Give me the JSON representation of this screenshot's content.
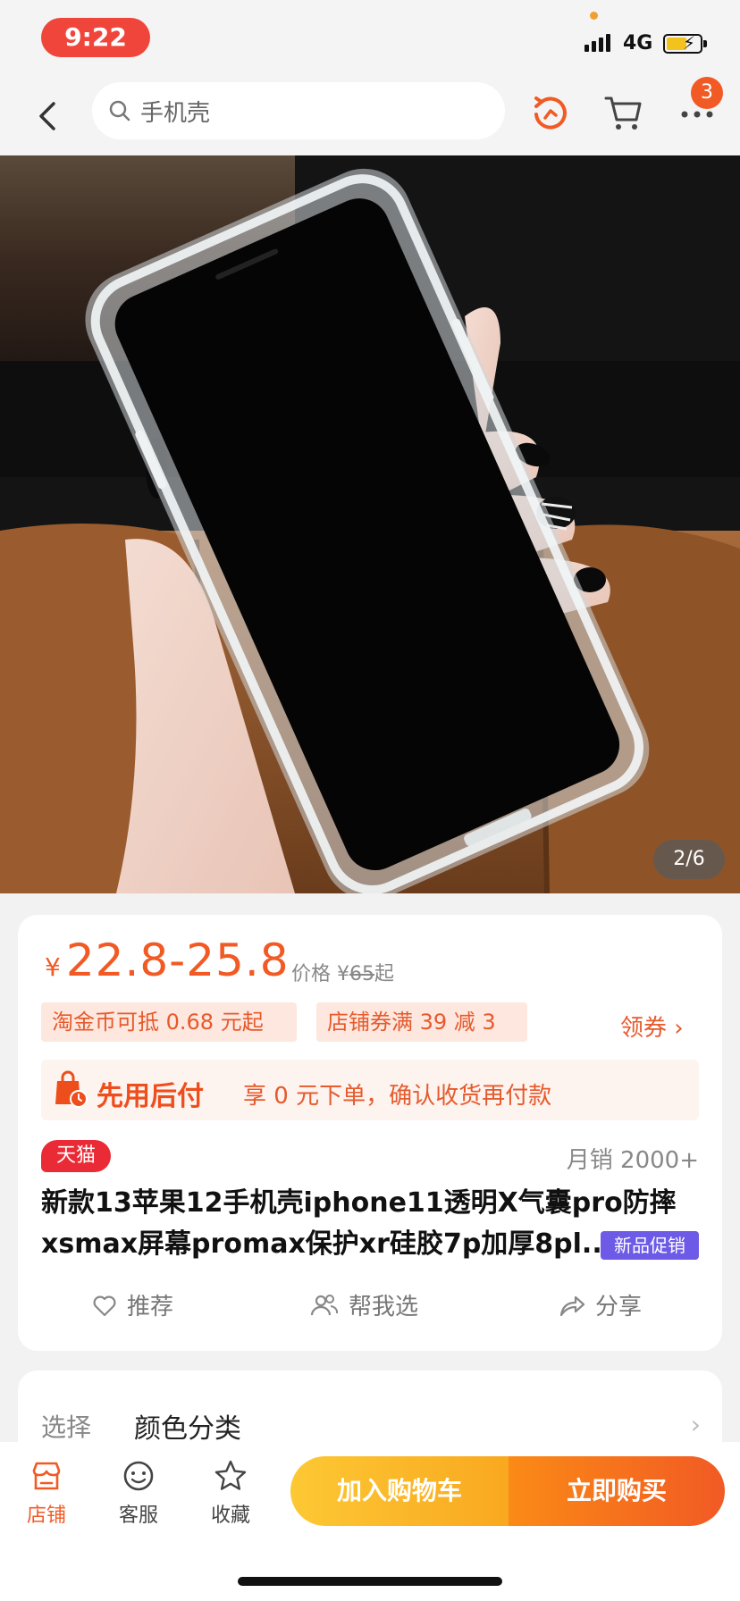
{
  "status_bar": {
    "time": "9:22",
    "network": "4G"
  },
  "nav": {
    "search_text": "手机壳",
    "cart_badge": "3"
  },
  "gallery": {
    "counter": "2/6"
  },
  "price": {
    "currency": "¥",
    "range": "22.8-25.8",
    "orig_label": "价格 ¥",
    "orig_value": "65",
    "orig_suffix": "起"
  },
  "coupons": {
    "item1": "淘金币可抵 0.68 元起",
    "item2": "店铺券满 39 减 3",
    "link": "领券 ›"
  },
  "paylater": {
    "title": "先用后付",
    "desc": "享 0 元下单，确认收货再付款"
  },
  "product": {
    "mall_badge": "天猫",
    "sales": "月销 2000+",
    "title_line1": "新款13苹果12手机壳iphone11透明X气囊pro防摔",
    "title_line2": "xsmax屏幕promax保护xr硅胶7p加厚8pl...",
    "promo_badge": "新品促销"
  },
  "actions": {
    "recommend": "推荐",
    "help_choose": "帮我选",
    "share": "分享"
  },
  "select": {
    "label": "选择",
    "value": "颜色分类",
    "chevron": "›"
  },
  "bottom": {
    "store": "店铺",
    "service": "客服",
    "favorite": "收藏",
    "add_cart": "加入购物车",
    "buy_now": "立即购买"
  },
  "colors": {
    "accent": "#f15a24",
    "tmall_red": "#ea2a35",
    "promo_purple": "#6d5ae6"
  },
  "icons": [
    "back-arrow",
    "search",
    "share-spin",
    "cart",
    "more-dots",
    "heart",
    "people",
    "share-arrow",
    "store",
    "service-face",
    "star",
    "shopping-bag"
  ]
}
